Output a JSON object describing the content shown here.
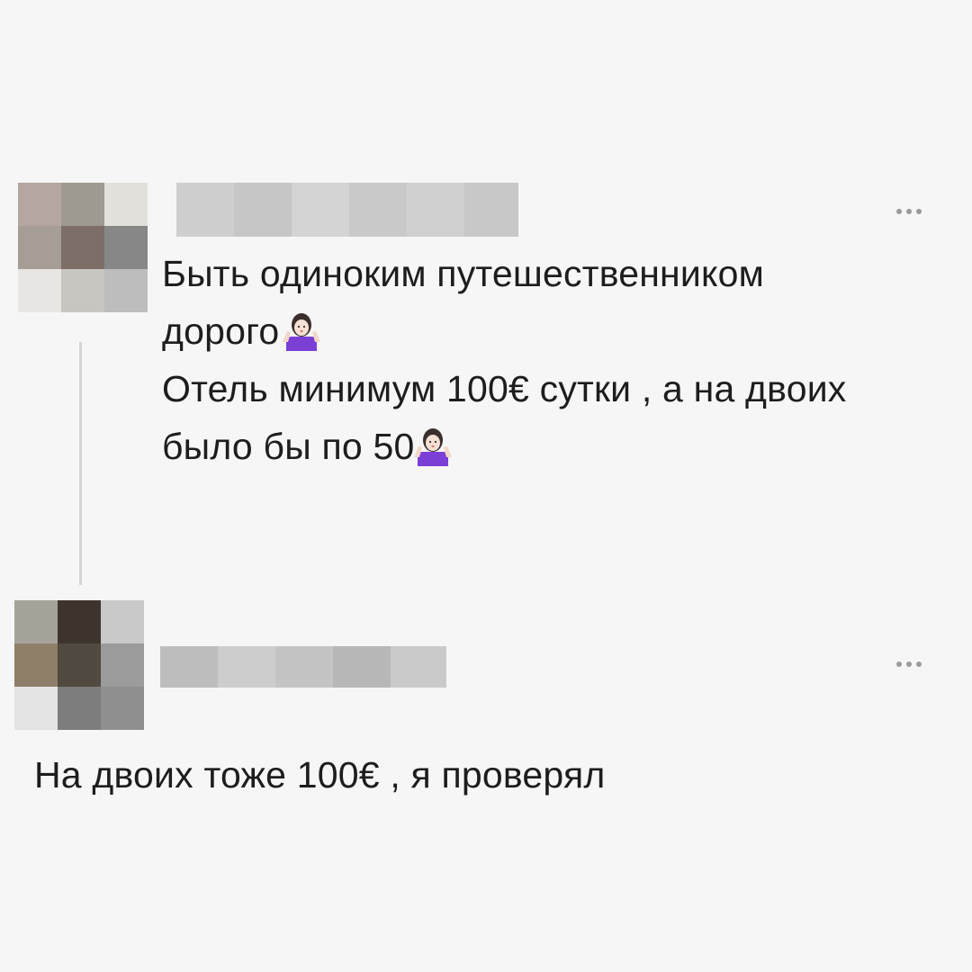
{
  "comments": [
    {
      "author_name": "",
      "text_lines": [
        "Быть одиноким путешественником",
        "дорого",
        "Отель минимум 100€ сутки , а на двоих",
        "было бы по 50"
      ],
      "emoji": "woman-shrugging-icon",
      "avatar_colors": [
        "#b5a69f",
        "#9f9a90",
        "#e2e0da",
        "#a79d97",
        "#7d6e67",
        "#878787",
        "#e8e6e2",
        "#c9c5c0",
        "#bdbdbd"
      ],
      "name_blur_colors": [
        "#cfcfcf",
        "#c6c6c6",
        "#d4d4d4",
        "#c9c9c9",
        "#d0d0d0",
        "#c8c8c8"
      ]
    },
    {
      "author_name": "",
      "text_lines": [
        "На двоих тоже 100€ , я проверял"
      ],
      "avatar_colors": [
        "#a6a39a",
        "#3d342e",
        "#c9c9c9",
        "#8f7e68",
        "#504a40",
        "#9b9b9b",
        "#e4e4e4",
        "#7d7d7d",
        "#8f8f8f"
      ],
      "name_blur_colors": [
        "#bdbdbd",
        "#cdcdcd",
        "#c4c4c4",
        "#b7b7b7",
        "#cacaca"
      ]
    }
  ],
  "colors": {
    "background": "#f6f6f6",
    "text": "#1d1d1d",
    "emoji_shirt": "#7b3fd6",
    "thread_line": "#d4d4d4"
  }
}
